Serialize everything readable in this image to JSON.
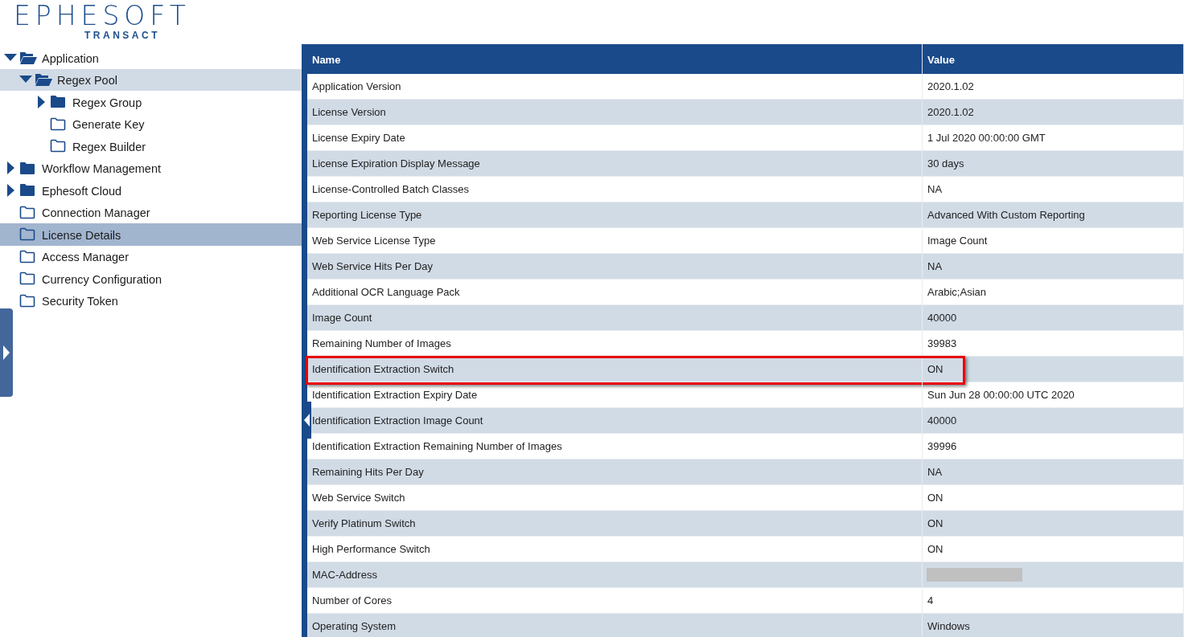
{
  "logo": {
    "name": "EPHESOFT",
    "product": "TRANSACT"
  },
  "tree": [
    {
      "label": "Application",
      "kind": "branch",
      "expanded": true,
      "selected": false,
      "highlighted": false,
      "children": [
        {
          "label": "Regex Pool",
          "kind": "branch",
          "expanded": true,
          "selected": false,
          "highlighted": true,
          "children": [
            {
              "label": "Regex Group",
              "kind": "branch",
              "expanded": false,
              "selected": false,
              "highlighted": false
            },
            {
              "label": "Generate Key",
              "kind": "leaf",
              "selected": false,
              "highlighted": false
            },
            {
              "label": "Regex Builder",
              "kind": "leaf",
              "selected": false,
              "highlighted": false
            }
          ]
        }
      ]
    },
    {
      "label": "Workflow Management",
      "kind": "branch",
      "expanded": false,
      "selected": false,
      "highlighted": false
    },
    {
      "label": "Ephesoft Cloud",
      "kind": "branch",
      "expanded": false,
      "selected": false,
      "highlighted": false
    },
    {
      "label": "Connection Manager",
      "kind": "leaf",
      "selected": false,
      "highlighted": false
    },
    {
      "label": "License Details",
      "kind": "leaf",
      "selected": true,
      "highlighted": false
    },
    {
      "label": "Access Manager",
      "kind": "leaf",
      "selected": false,
      "highlighted": false
    },
    {
      "label": "Currency Configuration",
      "kind": "leaf",
      "selected": false,
      "highlighted": false
    },
    {
      "label": "Security Token",
      "kind": "leaf",
      "selected": false,
      "highlighted": false
    }
  ],
  "table": {
    "columns": [
      "Name",
      "Value"
    ],
    "rows": [
      {
        "name": "Application Version",
        "value": "2020.1.02",
        "highlighted": false,
        "redacted": false
      },
      {
        "name": "License Version",
        "value": "2020.1.02",
        "highlighted": false,
        "redacted": false
      },
      {
        "name": "License Expiry Date",
        "value": "1 Jul 2020 00:00:00 GMT",
        "highlighted": false,
        "redacted": false
      },
      {
        "name": "License Expiration Display Message",
        "value": "30 days",
        "highlighted": false,
        "redacted": false
      },
      {
        "name": "License-Controlled Batch Classes",
        "value": "NA",
        "highlighted": false,
        "redacted": false
      },
      {
        "name": "Reporting License Type",
        "value": "Advanced With Custom Reporting",
        "highlighted": false,
        "redacted": false
      },
      {
        "name": "Web Service License Type",
        "value": "Image Count",
        "highlighted": false,
        "redacted": false
      },
      {
        "name": "Web Service Hits Per Day",
        "value": "NA",
        "highlighted": false,
        "redacted": false
      },
      {
        "name": "Additional OCR Language Pack",
        "value": "Arabic;Asian",
        "highlighted": false,
        "redacted": false
      },
      {
        "name": "Image Count",
        "value": "40000",
        "highlighted": false,
        "redacted": false
      },
      {
        "name": "Remaining Number of Images",
        "value": "39983",
        "highlighted": false,
        "redacted": false
      },
      {
        "name": "Identification Extraction Switch",
        "value": "ON",
        "highlighted": true,
        "redacted": false
      },
      {
        "name": "Identification Extraction Expiry Date",
        "value": "Sun Jun 28 00:00:00 UTC 2020",
        "highlighted": false,
        "redacted": false
      },
      {
        "name": "Identification Extraction Image Count",
        "value": "40000",
        "highlighted": false,
        "redacted": false
      },
      {
        "name": "Identification Extraction Remaining Number of Images",
        "value": "39996",
        "highlighted": false,
        "redacted": false
      },
      {
        "name": "Remaining Hits Per Day",
        "value": "NA",
        "highlighted": false,
        "redacted": false
      },
      {
        "name": "Web Service Switch",
        "value": "ON",
        "highlighted": false,
        "redacted": false
      },
      {
        "name": "Verify Platinum Switch",
        "value": "ON",
        "highlighted": false,
        "redacted": false
      },
      {
        "name": "High Performance Switch",
        "value": "ON",
        "highlighted": false,
        "redacted": false
      },
      {
        "name": "MAC-Address",
        "highlighted": false,
        "redacted": true
      },
      {
        "name": "Number of Cores",
        "value": "4",
        "highlighted": false,
        "redacted": false
      },
      {
        "name": "Operating System",
        "value": "Windows",
        "highlighted": false,
        "redacted": false
      }
    ]
  }
}
